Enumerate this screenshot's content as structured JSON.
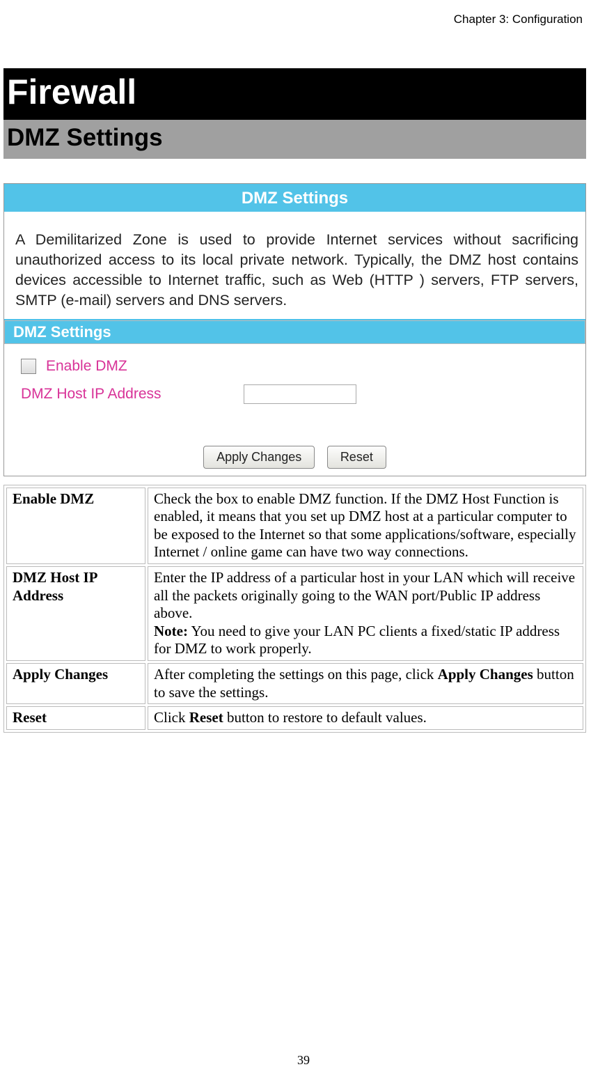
{
  "chapter_header": "Chapter 3: Configuration",
  "title": "Firewall",
  "subtitle": "DMZ Settings",
  "screenshot": {
    "panel_title": "DMZ Settings",
    "description": "A Demilitarized Zone is used to provide Internet services without sacrificing unauthorized access to its local private network. Typically, the DMZ host contains devices accessible to Internet traffic, such as Web (HTTP ) servers, FTP servers, SMTP (e-mail) servers and DNS servers.",
    "section_title": "DMZ Settings",
    "enable_label": "Enable DMZ",
    "ip_label": "DMZ Host IP Address",
    "apply_button": "Apply Changes",
    "reset_button": "Reset"
  },
  "table": {
    "rows": [
      {
        "term": "Enable DMZ",
        "desc": "Check the box to enable DMZ function. If the DMZ Host Function is enabled, it means that you set up DMZ host at a particular computer to be exposed to the Internet so that some applications/software, especially Internet / online game can have two way connections."
      },
      {
        "term": "DMZ Host IP Address",
        "desc_pre": "Enter the IP address of a particular host in your LAN which will receive all the packets originally going to the WAN port/Public IP address above.",
        "note_label": "Note:",
        "note_text": " You need to give your LAN PC clients a fixed/static IP address for DMZ to work properly."
      },
      {
        "term": "Apply Changes",
        "desc_pre": "After completing the settings on this page, click ",
        "bold": "Apply Changes",
        "desc_post": " button to save the settings."
      },
      {
        "term": "Reset",
        "desc_pre": "Click ",
        "bold": "Reset",
        "desc_post": " button to restore to default values."
      }
    ]
  },
  "page_number": "39"
}
